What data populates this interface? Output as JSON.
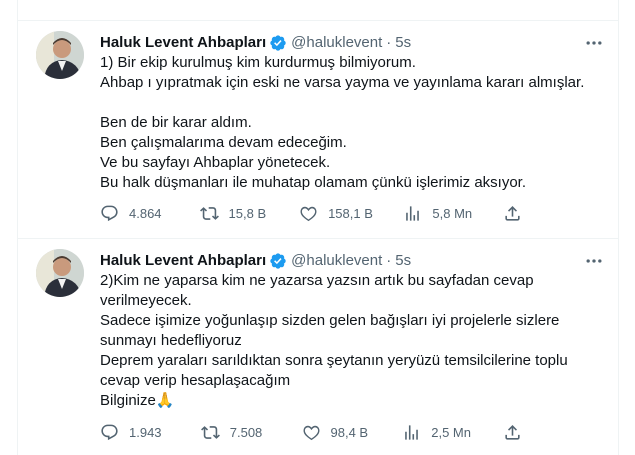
{
  "tweets": [
    {
      "author": {
        "name": "Haluk Levent Ahbapları",
        "handle": "@haluklevent",
        "time": "5s"
      },
      "lines": [
        "1) Bir ekip kurulmuş kim kurdurmuş bilmiyorum.",
        "Ahbap ı yıpratmak için eski ne varsa yayma ve yayınlama kararı almışlar.",
        "",
        "Ben de bir karar aldım.",
        "Ben çalışmalarıma devam edeceğim.",
        "Ve bu sayfayı Ahbaplar yönetecek.",
        "Bu halk düşmanları ile muhatap olamam çünkü işlerimiz aksıyor."
      ],
      "stats": {
        "replies": "4.864",
        "retweets": "15,8 B",
        "likes": "158,1 B",
        "views": "5,8 Mn"
      }
    },
    {
      "author": {
        "name": "Haluk Levent Ahbapları",
        "handle": "@haluklevent",
        "time": "5s"
      },
      "lines": [
        "2)Kim ne yaparsa kim ne yazarsa yazsın artık bu sayfadan cevap",
        "verilmeyecek.",
        "Sadece işimize yoğunlaşıp sizden gelen bağışları iyi projelerle sizlere",
        "sunmayı hedefliyoruz",
        "Deprem yaraları sarıldıktan sonra şeytanın yeryüzü temsilcilerine toplu",
        "cevap verip hesaplaşacağım",
        "Bilginize🙏"
      ],
      "stats": {
        "replies": "1.943",
        "retweets": "7.508",
        "likes": "98,4 B",
        "views": "2,5 Mn"
      }
    }
  ],
  "icons": [
    "verified-badge-icon",
    "more-icon",
    "reply-icon",
    "retweet-icon",
    "like-icon",
    "views-icon",
    "share-icon"
  ],
  "colors": {
    "verified": "#1d9bf0",
    "muted": "#536471",
    "text": "#0f1419",
    "border": "#eff3f4"
  }
}
